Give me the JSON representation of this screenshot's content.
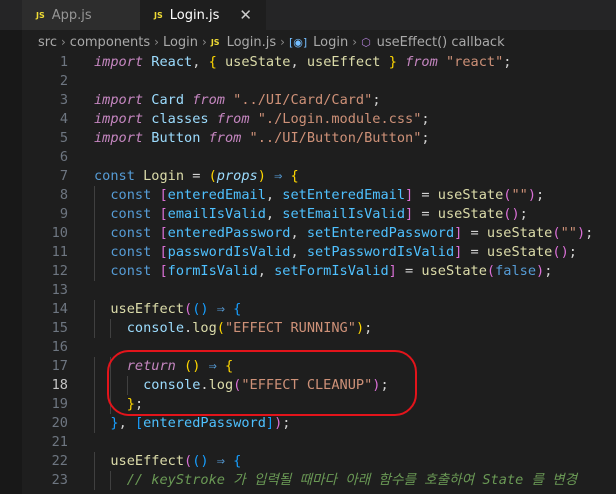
{
  "tabs": [
    {
      "badge": "JS",
      "label": "App.js",
      "active": false
    },
    {
      "badge": "JS",
      "label": "Login.js",
      "active": true,
      "close": "✕"
    }
  ],
  "breadcrumb": [
    "src",
    "components",
    "Login",
    "Login.js",
    "Login",
    "useEffect() callback"
  ],
  "lines": [
    {
      "n": "1",
      "t": "import React, { useState, useEffect } from \"react\";"
    },
    {
      "n": "2",
      "t": ""
    },
    {
      "n": "3",
      "t": "import Card from \"../UI/Card/Card\";"
    },
    {
      "n": "4",
      "t": "import classes from \"./Login.module.css\";"
    },
    {
      "n": "5",
      "t": "import Button from \"../UI/Button/Button\";"
    },
    {
      "n": "6",
      "t": ""
    },
    {
      "n": "7",
      "t": "const Login = (props) ⇒ {"
    },
    {
      "n": "8",
      "t": "  const [enteredEmail, setEnteredEmail] = useState(\"\");"
    },
    {
      "n": "9",
      "t": "  const [emailIsValid, setEmailIsValid] = useState();"
    },
    {
      "n": "10",
      "t": "  const [enteredPassword, setEnteredPassword] = useState(\"\");"
    },
    {
      "n": "11",
      "t": "  const [passwordIsValid, setPasswordIsValid] = useState();"
    },
    {
      "n": "12",
      "t": "  const [formIsValid, setFormIsValid] = useState(false);"
    },
    {
      "n": "13",
      "t": ""
    },
    {
      "n": "14",
      "t": "  useEffect(() ⇒ {"
    },
    {
      "n": "15",
      "t": "    console.log(\"EFFECT RUNNING\");"
    },
    {
      "n": "16",
      "t": ""
    },
    {
      "n": "17",
      "t": "    return () ⇒ {"
    },
    {
      "n": "18",
      "t": "      console.log(\"EFFECT CLEANUP\");"
    },
    {
      "n": "19",
      "t": "    };"
    },
    {
      "n": "20",
      "t": "  }, [enteredPassword]);"
    },
    {
      "n": "21",
      "t": ""
    },
    {
      "n": "22",
      "t": "  useEffect(() ⇒ {"
    },
    {
      "n": "23",
      "t": "    // keyStroke 가 입력될 때마다 아래 함수를 호출하여 State 를 변경"
    }
  ],
  "current_line": "18",
  "colors": {
    "annotation": "#e3141b",
    "background": "#1e1e1e"
  }
}
